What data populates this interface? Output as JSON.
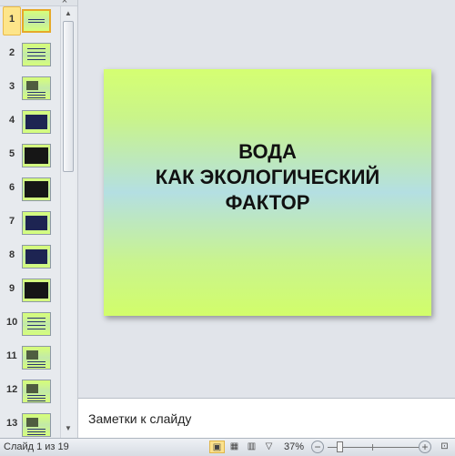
{
  "slide": {
    "title_line1": "ВОДА",
    "title_line2": "КАК ЭКОЛОГИЧЕСКИЙ",
    "title_line3": "ФАКТОР"
  },
  "notes": {
    "placeholder": "Заметки к слайду"
  },
  "thumbnails": [
    {
      "num": "1",
      "style": "title"
    },
    {
      "num": "2",
      "style": "text"
    },
    {
      "num": "3",
      "style": "photo"
    },
    {
      "num": "4",
      "style": "dark"
    },
    {
      "num": "5",
      "style": "dark2"
    },
    {
      "num": "6",
      "style": "dark2"
    },
    {
      "num": "7",
      "style": "dark"
    },
    {
      "num": "8",
      "style": "dark"
    },
    {
      "num": "9",
      "style": "dark2"
    },
    {
      "num": "10",
      "style": "text"
    },
    {
      "num": "11",
      "style": "photo"
    },
    {
      "num": "12",
      "style": "photo"
    },
    {
      "num": "13",
      "style": "photo"
    }
  ],
  "pane": {
    "close_icon": "×"
  },
  "status": {
    "slide_counter": "Слайд 1 из 19",
    "zoom": "37%",
    "zoom_out": "−",
    "zoom_in": "+"
  }
}
